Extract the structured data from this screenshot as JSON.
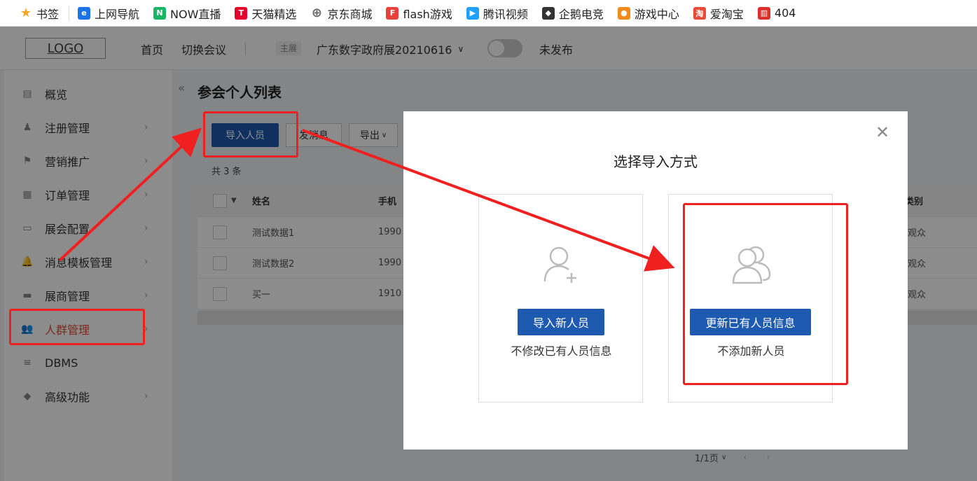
{
  "bookmarks": [
    {
      "label": "书签",
      "icon": "star-icon",
      "color": "#f5a623",
      "glyph": "★"
    },
    {
      "label": "上网导航",
      "icon": "ie-icon",
      "color": "#1a73e8",
      "glyph": "e"
    },
    {
      "label": "NOW直播",
      "icon": "now-live-icon",
      "color": "#18b566",
      "glyph": "N"
    },
    {
      "label": "天猫精选",
      "icon": "tmall-icon",
      "color": "#e4002b",
      "glyph": "T"
    },
    {
      "label": "京东商城",
      "icon": "globe-icon",
      "color": "#666666",
      "glyph": "⊕"
    },
    {
      "label": "flash游戏",
      "icon": "flash-game-icon",
      "color": "#e8403a",
      "glyph": "F"
    },
    {
      "label": "腾讯视频",
      "icon": "tencent-video-icon",
      "color": "#20a0ff",
      "glyph": "▶"
    },
    {
      "label": "企鹅电竞",
      "icon": "penguin-esports-icon",
      "color": "#333333",
      "glyph": "◆"
    },
    {
      "label": "游戏中心",
      "icon": "gamepad-icon",
      "color": "#f28b1c",
      "glyph": "●"
    },
    {
      "label": "爱淘宝",
      "icon": "taobao-icon",
      "color": "#e94b35",
      "glyph": "淘"
    },
    {
      "label": "404",
      "icon": "chart-bar-icon",
      "color": "#d9302c",
      "glyph": "▥"
    }
  ],
  "header": {
    "logo": "LOGO",
    "home": "首页",
    "switch_meeting": "切换会议",
    "host_tag": "主展",
    "exhibition": "广东数字政府展20210616",
    "publish_status": "未发布"
  },
  "sidebar": {
    "items": [
      {
        "label": "概览",
        "has_arrow": false
      },
      {
        "label": "注册管理",
        "has_arrow": true
      },
      {
        "label": "营销推广",
        "has_arrow": true
      },
      {
        "label": "订单管理",
        "has_arrow": true
      },
      {
        "label": "展会配置",
        "has_arrow": true
      },
      {
        "label": "消息模板管理",
        "has_arrow": true
      },
      {
        "label": "展商管理",
        "has_arrow": true
      },
      {
        "label": "人群管理",
        "has_arrow": true,
        "active": true
      },
      {
        "label": "DBMS",
        "has_arrow": false
      },
      {
        "label": "高级功能",
        "has_arrow": true
      }
    ]
  },
  "main": {
    "title": "参会个人列表",
    "toolbar": {
      "import": "导入人员",
      "send_message": "发消息",
      "export": "导出"
    },
    "count": "共 3 条",
    "table": {
      "headers": {
        "name": "姓名",
        "phone": "手机",
        "category": "类别"
      },
      "rows": [
        {
          "name": "测试数据1",
          "phone": "1990",
          "category": "观众"
        },
        {
          "name": "测试数据2",
          "phone": "1990",
          "category": "观众"
        },
        {
          "name": "买一",
          "phone": "1910",
          "category": "观众"
        }
      ]
    },
    "pager": "1/1页"
  },
  "modal": {
    "title": "选择导入方式",
    "options": [
      {
        "button": "导入新人员",
        "subtitle": "不修改已有人员信息",
        "icon": "add-user-icon"
      },
      {
        "button": "更新已有人员信息",
        "subtitle": "不添加新人员",
        "icon": "users-icon"
      }
    ]
  },
  "colors": {
    "primary": "#1e5ab0",
    "accent_red": "#f02020",
    "active_menu": "#e34b30"
  }
}
